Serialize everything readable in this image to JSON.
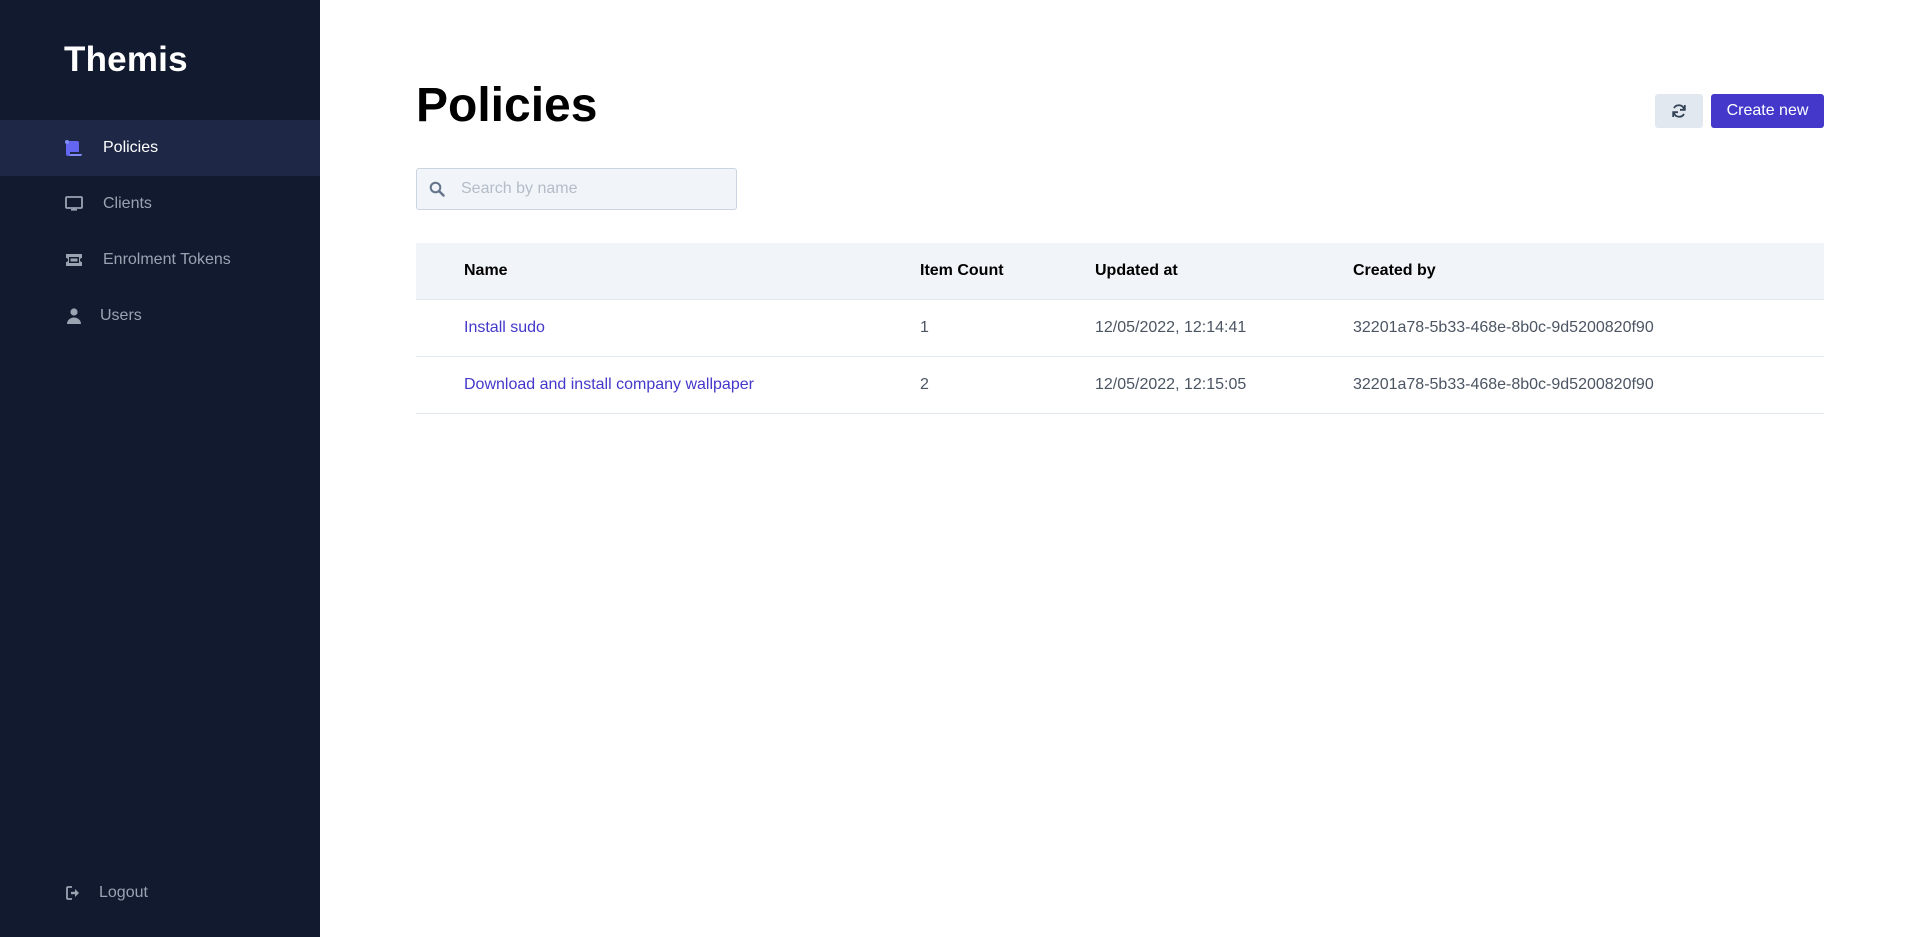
{
  "app": {
    "title": "Themis"
  },
  "sidebar": {
    "items": [
      {
        "label": "Policies",
        "icon": "policies-icon",
        "active": true
      },
      {
        "label": "Clients",
        "icon": "monitor-icon",
        "active": false
      },
      {
        "label": "Enrolment Tokens",
        "icon": "ticket-icon",
        "active": false
      },
      {
        "label": "Users",
        "icon": "user-icon",
        "active": false
      }
    ],
    "logout_label": "Logout"
  },
  "header": {
    "title": "Policies",
    "create_label": "Create new"
  },
  "search": {
    "placeholder": "Search by name",
    "value": ""
  },
  "table": {
    "columns": [
      "Name",
      "Item Count",
      "Updated at",
      "Created by"
    ],
    "rows": [
      {
        "name": "Install sudo",
        "item_count": "1",
        "updated_at": "12/05/2022, 12:14:41",
        "created_by": "32201a78-5b33-468e-8b0c-9d5200820f90"
      },
      {
        "name": "Download and install company wallpaper",
        "item_count": "2",
        "updated_at": "12/05/2022, 12:15:05",
        "created_by": "32201a78-5b33-468e-8b0c-9d5200820f90"
      }
    ]
  },
  "colors": {
    "sidebar_bg": "#111a2e",
    "sidebar_active_bg": "#1e2846",
    "accent": "#4338ca",
    "active_icon": "#6366f1"
  }
}
